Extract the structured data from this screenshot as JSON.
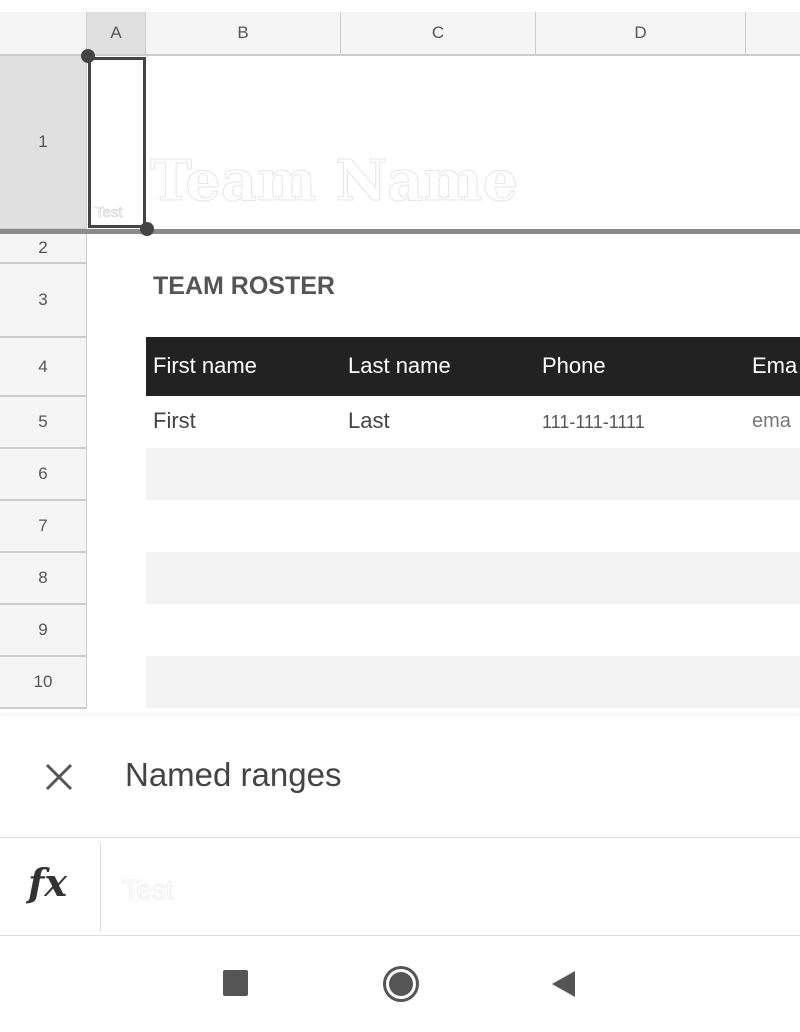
{
  "columns": [
    "A",
    "B",
    "C",
    "D"
  ],
  "rows": [
    "1",
    "2",
    "3",
    "4",
    "5",
    "6",
    "7",
    "8",
    "9",
    "10"
  ],
  "sheet": {
    "team_name": "Team Name",
    "selected_cell_text": "Test",
    "roster_title": "TEAM ROSTER",
    "headers": [
      "First name",
      "Last name",
      "Phone",
      "Ema"
    ],
    "row5": [
      "First",
      "Last",
      "111-111-1111",
      "ema"
    ]
  },
  "panel": {
    "title": "Named ranges",
    "close_icon": "close-icon"
  },
  "formula_bar": {
    "icon": "fx-icon",
    "fx_label": "fx",
    "value": "Test"
  },
  "navbar": {
    "icons": [
      "recent-apps-icon",
      "home-icon",
      "back-icon"
    ]
  },
  "colors": {
    "header_dark": "#222222",
    "band": "#f3f3f3",
    "selection": "#444444"
  }
}
